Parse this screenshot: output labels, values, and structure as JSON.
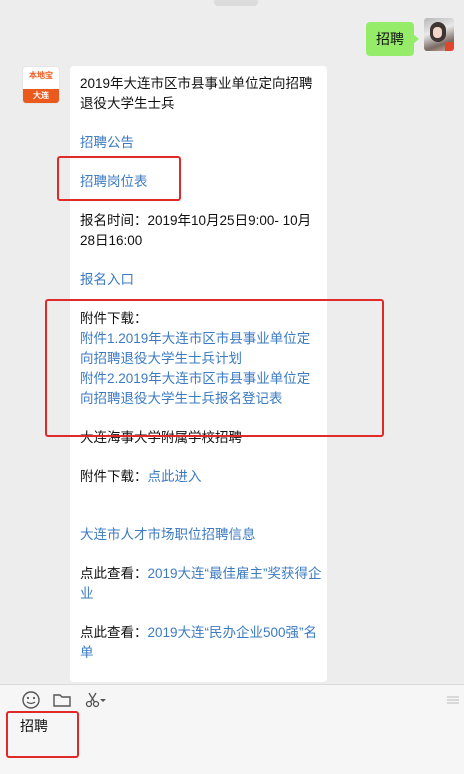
{
  "outgoing": {
    "text": "招聘"
  },
  "bot": {
    "brand": "本地宝",
    "city": "大连"
  },
  "message": {
    "title": "2019年大连市区市县事业单位定向招聘退役大学生士兵",
    "link_announcement": "招聘公告",
    "link_positions": "招聘岗位表",
    "signup_time": "报名时间：2019年10月25日9:00- 10月28日16:00",
    "link_signup": "报名入口",
    "attachments_label": "附件下载：",
    "attachment_1": "附件1.2019年大连市区市县事业单位定向招聘退役大学生士兵计划",
    "attachment_2": "附件2.2019年大连市区市县事业单位定向招聘退役大学生士兵报名登记表",
    "school_title": "大连海事大学附属学校招聘",
    "school_attach_label": "附件下载：",
    "school_attach_link": "点此进入",
    "talent_market_link": "大连市人才市场职位招聘信息",
    "view_label_1": "点此查看：",
    "view_link_1": "2019大连“最佳雇主”奖获得企业",
    "view_label_2": "点此查看：",
    "view_link_2": "2019大连“民办企业500强”名单"
  },
  "input": {
    "text": "招聘"
  }
}
